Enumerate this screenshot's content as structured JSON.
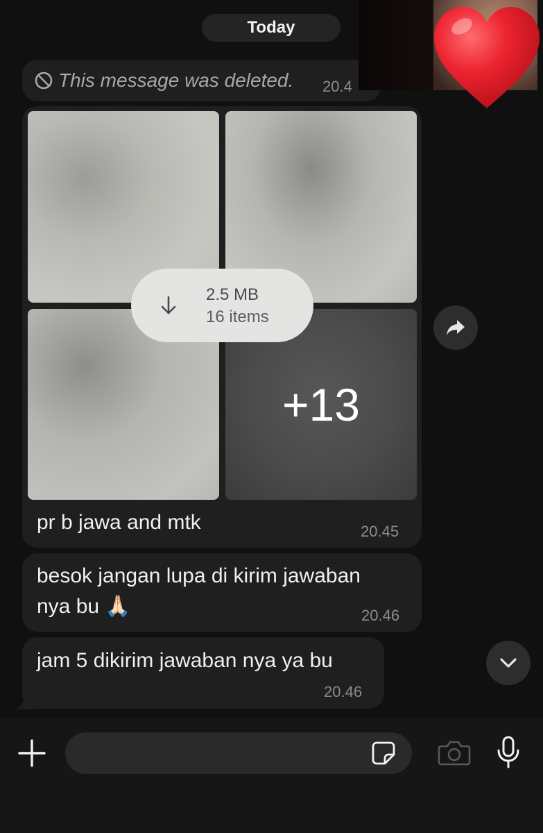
{
  "date_separator": "Today",
  "deleted_message": {
    "text": "This message was deleted.",
    "time": "20.4"
  },
  "album": {
    "download_size": "2.5 MB",
    "item_count": "16 items",
    "more_count": "+13",
    "caption": "pr b jawa and mtk",
    "time": "20.45"
  },
  "messages": [
    {
      "line1": "besok jangan lupa di kirim jawaban",
      "line2": "nya bu 🙏🏻",
      "time": "20.46"
    },
    {
      "text": "jam 5 dikirim jawaban nya ya bu",
      "time": "20.46"
    }
  ],
  "icons": {
    "deleted": "ban-icon",
    "download": "arrow-down-icon",
    "forward": "forward-icon",
    "scroll": "chevron-down-icon",
    "attach": "plus-icon",
    "sticker": "sticker-icon",
    "camera": "camera-icon",
    "mic": "microphone-icon",
    "reaction": "heart-icon"
  },
  "colors": {
    "background": "#101010",
    "bubble": "#1f1f1f",
    "timestamp": "#8c8c8c",
    "heart": "#e8202a"
  }
}
